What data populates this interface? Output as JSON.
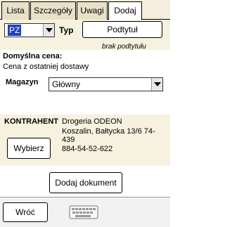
{
  "tabs": [
    {
      "label": "Lista"
    },
    {
      "label": "Szczegóły"
    },
    {
      "label": "Uwagi"
    },
    {
      "label": "Dodaj",
      "active": true
    }
  ],
  "doc_type": {
    "value": "PZ",
    "label": "Typ",
    "subtitle_button": "Podtytuł",
    "subtitle_text": "brak podtytułu"
  },
  "price": {
    "label": "Domyślna cena:",
    "value": "Cena z ostatniej dostawy"
  },
  "warehouse": {
    "label": "Magazyn",
    "value": "Główny"
  },
  "contractor": {
    "label": "KONTRAHENT",
    "line1": "Drogeria ODEON",
    "line2": "Koszalin, Bałtycka 13/6   74-",
    "line3": "439",
    "line4": "884-54-52-622",
    "choose_button": "Wybierz"
  },
  "add_document_button": "Dodaj dokument",
  "footer": {
    "back_button": "Wróć",
    "keyboard_icon": "keyboard-icon"
  }
}
